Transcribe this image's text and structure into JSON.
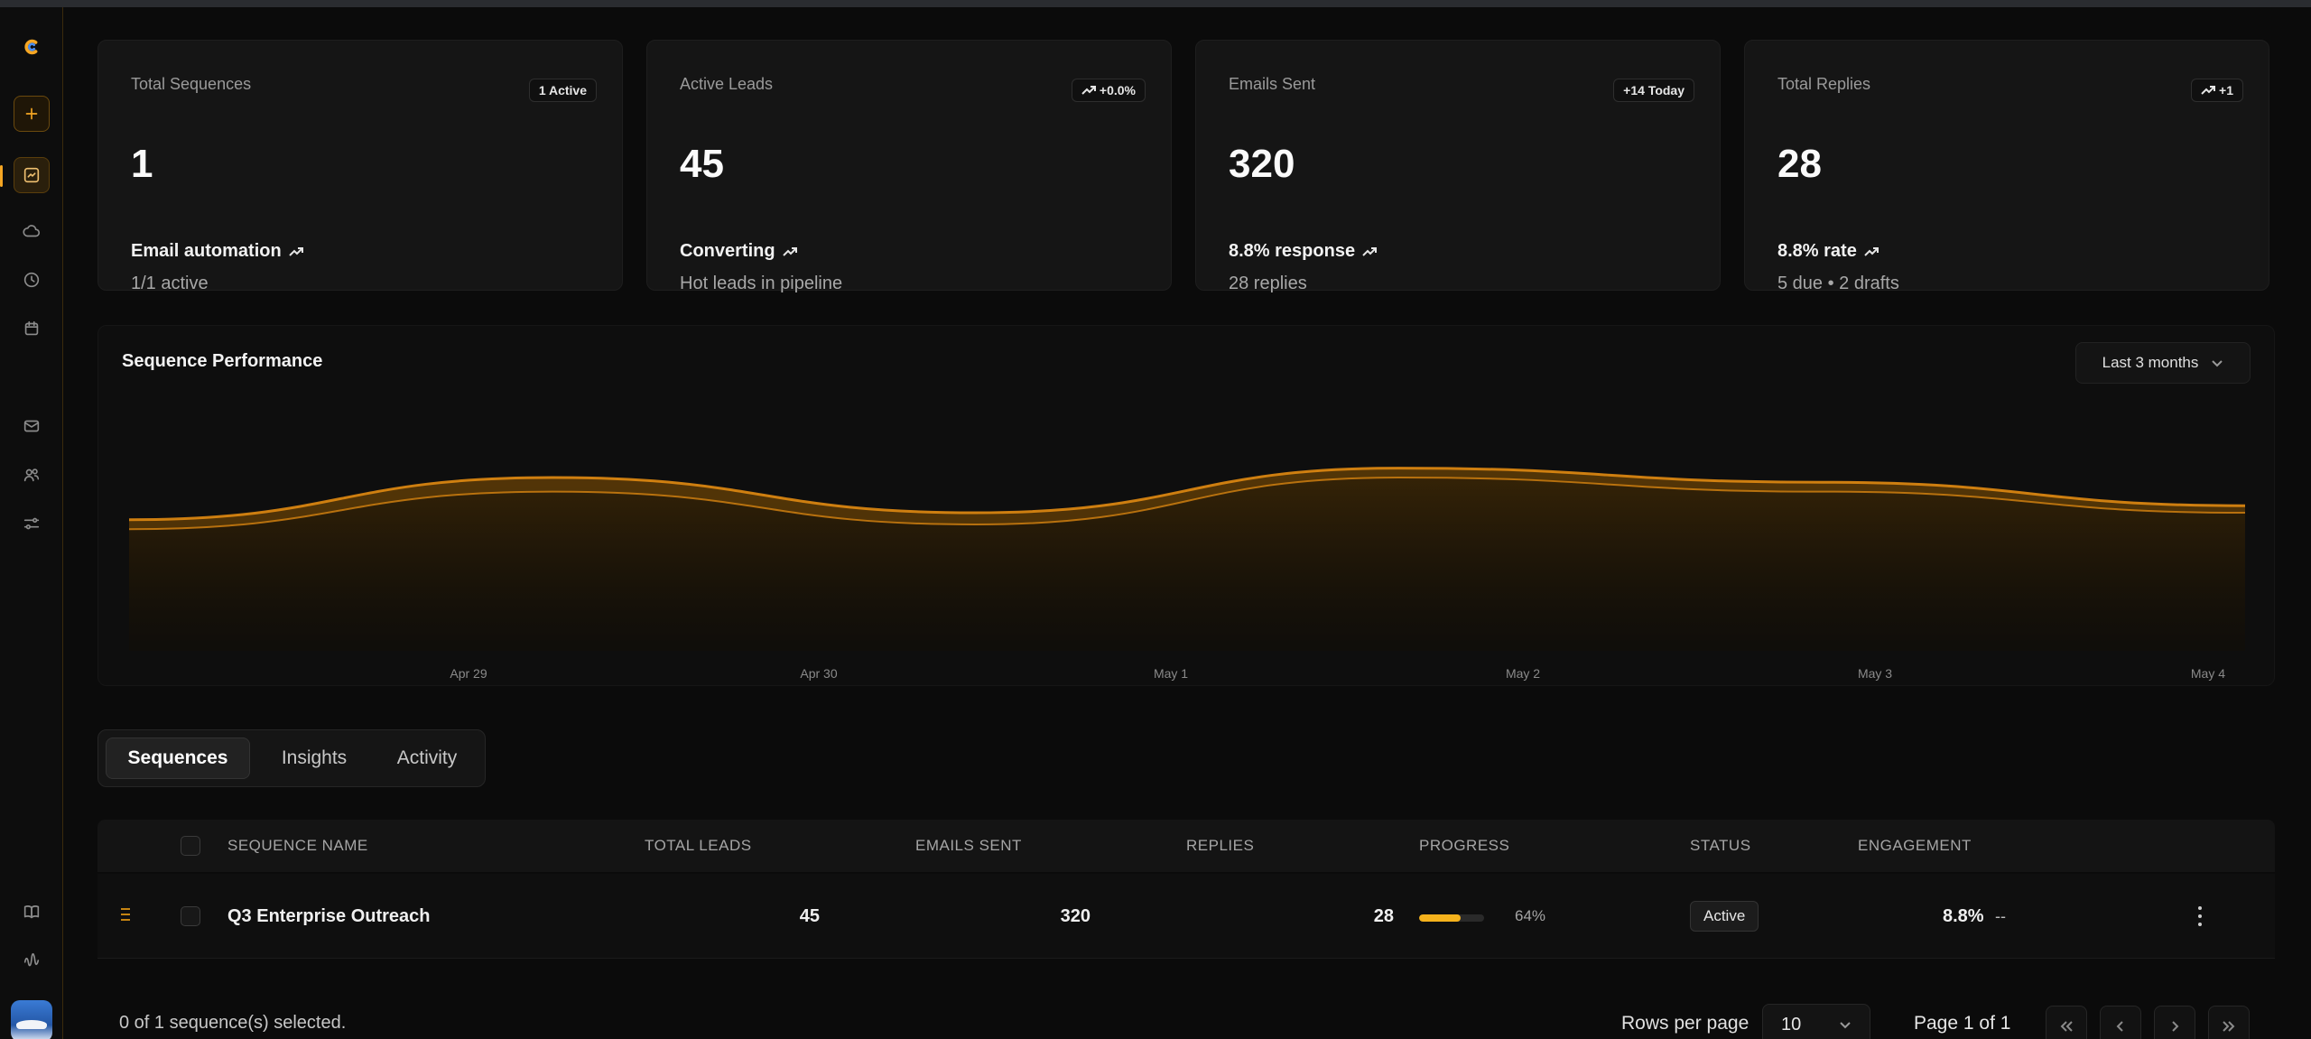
{
  "sidebar": {
    "icons": [
      "logo-icon",
      "add-icon",
      "dashboard-icon",
      "cloud-icon",
      "clock-icon",
      "calendar-icon",
      "mail-icon",
      "users-icon",
      "settings-sliders-icon",
      "book-icon",
      "waveform-icon"
    ]
  },
  "stats": [
    {
      "title": "Total Sequences",
      "value": "1",
      "badge": "1 Active",
      "badge_trend": false,
      "label": "Email automation",
      "sub": "1/1 active"
    },
    {
      "title": "Active Leads",
      "value": "45",
      "badge": "+0.0%",
      "badge_trend": true,
      "label": "Converting",
      "sub": "Hot leads in pipeline"
    },
    {
      "title": "Emails Sent",
      "value": "320",
      "badge": "+14 Today",
      "badge_trend": false,
      "label": "8.8% response",
      "sub": "28 replies"
    },
    {
      "title": "Total Replies",
      "value": "28",
      "badge": "+1",
      "badge_trend": true,
      "label": "8.8% rate",
      "sub": "5 due • 2 drafts"
    }
  ],
  "chart": {
    "title": "Sequence Performance",
    "range_label": "Last 3 months"
  },
  "chart_data": {
    "type": "area",
    "x": [
      "Apr 29",
      "Apr 30",
      "May 1",
      "May 2",
      "May 3",
      "May 4"
    ],
    "series": [
      {
        "values": [
          52,
          70,
          55,
          74,
          68,
          58
        ]
      },
      {
        "values": [
          48,
          64,
          50,
          70,
          64,
          55
        ]
      }
    ],
    "grid": false,
    "accent": "#e08a12"
  },
  "tabs": [
    {
      "label": "Sequences",
      "active": true
    },
    {
      "label": "Insights",
      "active": false
    },
    {
      "label": "Activity",
      "active": false
    }
  ],
  "table": {
    "headers": {
      "name": "SEQUENCE NAME",
      "leads": "TOTAL LEADS",
      "sent": "EMAILS SENT",
      "replies": "REPLIES",
      "progress": "PROGRESS",
      "status": "STATUS",
      "engagement": "ENGAGEMENT"
    },
    "rows": [
      {
        "name": "Q3 Enterprise Outreach",
        "leads": "45",
        "sent": "320",
        "replies": "28",
        "progress": 64,
        "progress_label": "64%",
        "status": "Active",
        "engagement": "8.8%",
        "engagement_suffix": "--"
      }
    ]
  },
  "footer": {
    "selected": "0 of 1 sequence(s) selected.",
    "rows_per_page_label": "Rows per page",
    "rows_per_page": "10",
    "page_label": "Page 1 of 1"
  },
  "colors": {
    "accent": "#f5a623",
    "background": "#0b0b0b",
    "card": "#151515"
  }
}
